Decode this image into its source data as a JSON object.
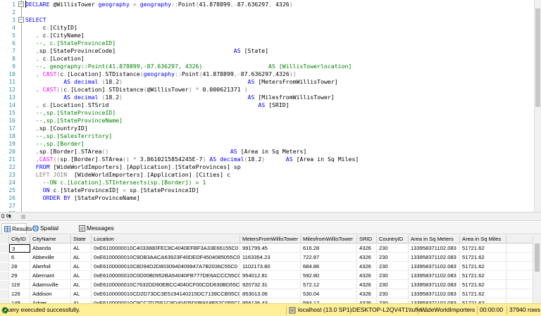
{
  "editor": {
    "lines": [
      {
        "n": "1",
        "segs": [
          [
            "kw",
            "DECLARE "
          ],
          [
            "",
            "@WillisTower "
          ],
          [
            "ty",
            "geography "
          ],
          [
            "gr",
            "= "
          ],
          [
            "ty",
            "geography"
          ],
          [
            "gr",
            "::"
          ],
          [
            "",
            "Point"
          ],
          [
            "gr",
            "("
          ],
          [
            "",
            "41.878899"
          ],
          [
            "gr",
            ","
          ],
          [
            "gr",
            "-"
          ],
          [
            "",
            "87.636297"
          ],
          [
            "gr",
            ", "
          ],
          [
            "",
            "4326"
          ],
          [
            "gr",
            ")"
          ]
        ]
      },
      {
        "n": "2",
        "segs": []
      },
      {
        "n": "3",
        "segs": [
          [
            "kw",
            "SELECT"
          ]
        ]
      },
      {
        "n": "4",
        "segs": [
          [
            "",
            "     c"
          ],
          [
            "gr",
            "."
          ],
          [
            "",
            "[CityID]"
          ]
        ]
      },
      {
        "n": "5",
        "segs": [
          [
            "gr",
            "   , "
          ],
          [
            "",
            "c"
          ],
          [
            "gr",
            "."
          ],
          [
            "",
            "[CityName]"
          ]
        ]
      },
      {
        "n": "6",
        "segs": [
          [
            "cm",
            "   --, c.[StateProvinceID]"
          ]
        ]
      },
      {
        "n": "7",
        "segs": [
          [
            "gr",
            "   ,"
          ],
          [
            "",
            "sp"
          ],
          [
            "gr",
            "."
          ],
          [
            "",
            "[StateProvinceCode]"
          ],
          [
            "",
            "                                  "
          ],
          [
            "kw",
            "AS "
          ],
          [
            "",
            "[State]"
          ]
        ]
      },
      {
        "n": "8",
        "segs": [
          [
            "gr",
            "   , "
          ],
          [
            "",
            "c"
          ],
          [
            "gr",
            "."
          ],
          [
            "",
            "[Location]"
          ]
        ]
      },
      {
        "n": "9",
        "segs": [
          [
            "cm",
            "   --, geography::Point(41.878899,-87.636297, 4326)                   AS [WillisTowerlocation]"
          ]
        ]
      },
      {
        "n": "10",
        "segs": [
          [
            "gr",
            "   , "
          ],
          [
            "fn",
            "CAST"
          ],
          [
            "gr",
            "("
          ],
          [
            "",
            "c"
          ],
          [
            "gr",
            "."
          ],
          [
            "",
            "[Location]"
          ],
          [
            "gr",
            "."
          ],
          [
            "",
            "STDistance"
          ],
          [
            "gr",
            "("
          ],
          [
            "ty",
            "geography"
          ],
          [
            "gr",
            "::"
          ],
          [
            "",
            "Point"
          ],
          [
            "gr",
            "("
          ],
          [
            "",
            "41.878899"
          ],
          [
            "gr",
            ","
          ],
          [
            "gr",
            "-"
          ],
          [
            "",
            "87.636297"
          ],
          [
            "gr",
            ","
          ],
          [
            "",
            "4326"
          ],
          [
            "gr",
            "))"
          ]
        ]
      },
      {
        "n": "11",
        "segs": [
          [
            "",
            "           "
          ],
          [
            "kw",
            "AS "
          ],
          [
            "ty",
            "decimal "
          ],
          [
            "gr",
            "("
          ],
          [
            "",
            "18"
          ],
          [
            "gr",
            ","
          ],
          [
            "",
            "2"
          ],
          [
            "gr",
            ")"
          ],
          [
            "",
            "                                    "
          ],
          [
            "kw",
            "AS "
          ],
          [
            "",
            "[MetersFromWillisTower]"
          ]
        ]
      },
      {
        "n": "12",
        "segs": [
          [
            "gr",
            "   , "
          ],
          [
            "fn",
            "CAST"
          ],
          [
            "gr",
            "(("
          ],
          [
            "",
            "c"
          ],
          [
            "gr",
            "."
          ],
          [
            "",
            "[Location]"
          ],
          [
            "gr",
            "."
          ],
          [
            "",
            "STDistance"
          ],
          [
            "gr",
            "("
          ],
          [
            "",
            "@WillisTower"
          ],
          [
            "gr",
            ") * "
          ],
          [
            "",
            "0.000621371 "
          ],
          [
            "gr",
            ")"
          ]
        ]
      },
      {
        "n": "13",
        "segs": [
          [
            "",
            "           "
          ],
          [
            "kw",
            "AS "
          ],
          [
            "ty",
            "decimal "
          ],
          [
            "gr",
            "("
          ],
          [
            "",
            "18"
          ],
          [
            "gr",
            ","
          ],
          [
            "",
            "2"
          ],
          [
            "gr",
            ")"
          ],
          [
            "",
            "                                    "
          ],
          [
            "kw",
            "AS "
          ],
          [
            "",
            "[MilesfromWillisTower]"
          ]
        ]
      },
      {
        "n": "14",
        "segs": [
          [
            "gr",
            "   , "
          ],
          [
            "",
            "c"
          ],
          [
            "gr",
            "."
          ],
          [
            "",
            "[Location]"
          ],
          [
            "gr",
            "."
          ],
          [
            "",
            "STSrid"
          ],
          [
            "",
            "                                           "
          ],
          [
            "kw",
            "AS "
          ],
          [
            "",
            "[SRID]"
          ]
        ]
      },
      {
        "n": "15",
        "segs": [
          [
            "cm",
            "   --,sp.[StateProvinceID]"
          ]
        ]
      },
      {
        "n": "16",
        "segs": [
          [
            "cm",
            "   --,sp.[StateProvinceName]"
          ]
        ]
      },
      {
        "n": "17",
        "segs": [
          [
            "gr",
            "   ,"
          ],
          [
            "",
            "sp"
          ],
          [
            "gr",
            "."
          ],
          [
            "",
            "[CountryID]"
          ]
        ]
      },
      {
        "n": "18",
        "segs": [
          [
            "cm",
            "   --,sp.[SalesTerritory]"
          ]
        ]
      },
      {
        "n": "19",
        "segs": [
          [
            "cm",
            "   --,sp.[Border]"
          ]
        ]
      },
      {
        "n": "20",
        "segs": [
          [
            "gr",
            "   ,"
          ],
          [
            "",
            "sp"
          ],
          [
            "gr",
            "."
          ],
          [
            "",
            "[Border]"
          ],
          [
            "gr",
            "."
          ],
          [
            "",
            "STArea"
          ],
          [
            "gr",
            "()"
          ],
          [
            "",
            "                                   "
          ],
          [
            "kw",
            "AS "
          ],
          [
            "",
            "[Area in Sq Meters]"
          ]
        ]
      },
      {
        "n": "21",
        "segs": [
          [
            "gr",
            "   ,"
          ],
          [
            "fn",
            "CAST"
          ],
          [
            "gr",
            "(("
          ],
          [
            "",
            "sp"
          ],
          [
            "gr",
            "."
          ],
          [
            "",
            "[Border]"
          ],
          [
            "gr",
            "."
          ],
          [
            "",
            "STArea"
          ],
          [
            "gr",
            "() * "
          ],
          [
            "",
            "3.8610215854245E-7"
          ],
          [
            "gr",
            ") "
          ],
          [
            "kw",
            "AS "
          ],
          [
            "ty",
            "decimal"
          ],
          [
            "gr",
            "("
          ],
          [
            "",
            "18"
          ],
          [
            "gr",
            ","
          ],
          [
            "",
            "2"
          ],
          [
            "gr",
            ")"
          ],
          [
            "",
            "      "
          ],
          [
            "kw",
            "AS "
          ],
          [
            "",
            "[Area in Sq Miles]"
          ]
        ]
      },
      {
        "n": "22",
        "segs": [
          [
            "kw",
            "   FROM "
          ],
          [
            "",
            "[WideWorldImporters]"
          ],
          [
            "gr",
            "."
          ],
          [
            "",
            "[Application]"
          ],
          [
            "gr",
            "."
          ],
          [
            "",
            "[StateProvinces] sp"
          ]
        ]
      },
      {
        "n": "23",
        "segs": [
          [
            "gr",
            "   LEFT JOIN  "
          ],
          [
            "",
            "[WideWorldImporters]"
          ],
          [
            "gr",
            "."
          ],
          [
            "",
            "[Application]"
          ],
          [
            "gr",
            "."
          ],
          [
            "",
            "[Cities] c"
          ]
        ]
      },
      {
        "n": "24",
        "segs": [
          [
            "cm",
            "     --ON c.[Location].STIntersects(sp.[Border]) = 1"
          ]
        ]
      },
      {
        "n": "25",
        "segs": [
          [
            "kw",
            "     ON "
          ],
          [
            "",
            "c"
          ],
          [
            "gr",
            "."
          ],
          [
            "",
            "[StateProvinceID] "
          ],
          [
            "gr",
            "= "
          ],
          [
            "",
            "sp"
          ],
          [
            "gr",
            "."
          ],
          [
            "",
            "[StateProvinceID]"
          ]
        ]
      },
      {
        "n": "26",
        "segs": [
          [
            "kw",
            "     ORDER BY "
          ],
          [
            "",
            "[StateProvinceName]"
          ]
        ]
      },
      {
        "n": "27",
        "segs": []
      },
      {
        "n": "28",
        "segs": []
      }
    ],
    "zoom": "0 %"
  },
  "tabs": [
    {
      "label": "Results",
      "icon": "grid-icon",
      "active": true
    },
    {
      "label": "Spatial results",
      "icon": "globe-icon",
      "active": false
    },
    {
      "label": "Messages",
      "icon": "messages-icon",
      "active": false
    }
  ],
  "grid": {
    "columns": [
      "CityID",
      "CityName",
      "State",
      "Location",
      "MetersFromWillisTower",
      "MilesfromWillisTower",
      "SRID",
      "CountryID",
      "Area in Sq Meters",
      "Area in Sq Miles"
    ],
    "rows": [
      [
        "3",
        "Abanda",
        "AL",
        "0xE6100000010C4033880FEC8C4040EFBF3A33E66155C0",
        "991799.45",
        "616.28",
        "4326",
        "230",
        "133958371102.083",
        "51721.62"
      ],
      [
        "6",
        "Abbeville",
        "AL",
        "0xE6100000010C9DB3AACA63923F40DEDF4504085055C0",
        "1163354.23",
        "722.87",
        "4326",
        "230",
        "133958371102.083",
        "51721.62"
      ],
      [
        "28",
        "Aberfoil",
        "AL",
        "0xE6100000010C8D94D2D8030940409947A7B2036C55C0",
        "1102173.80",
        "684.86",
        "4326",
        "230",
        "133958371102.083",
        "51721.62"
      ],
      [
        "29",
        "Abernant",
        "AL",
        "0xE6100000010C0D00B0952BA54040FB777DE6ACCC55C0",
        "954012.81",
        "592.80",
        "4326",
        "230",
        "133958371102.083",
        "51721.62"
      ],
      [
        "119",
        "Adamsville",
        "AL",
        "0xE6100000010C7632DD90EBCC4040CF00CDD630BD55C0",
        "920732.31",
        "572.12",
        "4326",
        "230",
        "133958371102.083",
        "51721.62"
      ],
      [
        "126",
        "Addison",
        "AL",
        "0xE6100000010CD2D73DC3E5194140215DC7139CCB55C0",
        "853013.06",
        "530.04",
        "4326",
        "230",
        "133958371102.083",
        "51721.62"
      ],
      [
        "148",
        "Adger",
        "AL",
        "0xE6100000010C9CC7D75F1C8D40405D0B9A9E52C055C0",
        "956136.43",
        "594.12",
        "4326",
        "230",
        "133958371102.083",
        "51721.62"
      ]
    ]
  },
  "status": {
    "message": "Query executed successfully.",
    "server": "localhost (13.0 SP1)",
    "user": "DESKTOP-L2QV4T1\\tufte ...",
    "database": "WideWorldImporters",
    "time": "00:00:00",
    "rows": "37940 rows"
  }
}
